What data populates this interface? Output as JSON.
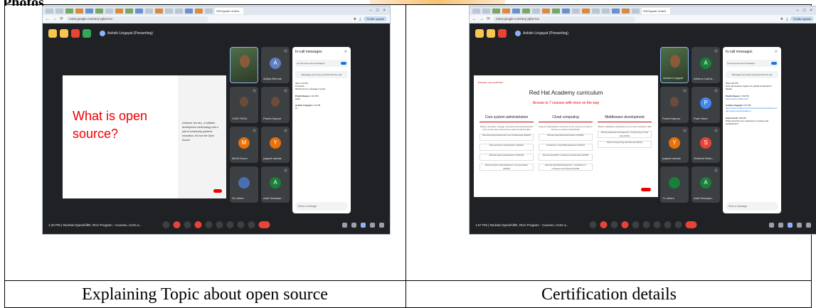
{
  "heading": "Photos",
  "captions": {
    "left": "Explaining Topic about open source",
    "right": "Certification details"
  },
  "shot_common": {
    "tab_title": "ISKOguide United States",
    "url": "meet.google.com/any-jqhw-ivo",
    "profile": "Profile update",
    "presenting": "Ashish Lingayat (Presenting)",
    "chat_title": "In-call messages",
    "chat_toggle": "Let everyone send messages",
    "chat_note": "Messages are being recorded with the call",
    "send_placeholder": "Send a message",
    "meeting_name": "RedHat OpenshiftR, RHA Program - Courses, Certs a..."
  },
  "shot1": {
    "time": "1:20 PM",
    "slide_title": "What is open source?",
    "slide_side": "A license, fan-dev., a software development methodology and a part of community-powered innovation. It's how the Open Source",
    "tiles": [
      {
        "name": "",
        "initial": "",
        "color": "cam"
      },
      {
        "name": "Aditya Bhende",
        "initial": "A",
        "color": "#5f7fbf"
      },
      {
        "name": "VINIT PATIL",
        "initial": "",
        "color": "photo"
      },
      {
        "name": "Prachi Kapoor",
        "initial": "",
        "color": "photo"
      },
      {
        "name": "Mohit Doore",
        "initial": "M",
        "color": "#e8710a"
      },
      {
        "name": "yogesh sabale",
        "initial": "Y",
        "color": "#e8710a"
      },
      {
        "name": "29 others",
        "initial": "",
        "color": "#4a6fb0"
      },
      {
        "name": "Aarti Deshpan...",
        "initial": "A",
        "color": "#188038"
      }
    ],
    "messages": [
      {
        "who": "You",
        "time": "1:13 PM",
        "text": "Hi Ashish",
        "extra": "Would send a message in pretti"
      },
      {
        "who": "Prachi Kapoor",
        "time": "1:16 PM",
        "text": "Hello",
        "extra": ""
      },
      {
        "who": "Ashish Lingayat",
        "time": "1:16 PM",
        "text": "Hi",
        "extra": ""
      }
    ]
  },
  "shot2": {
    "time": "1:57 PM",
    "slide_tiny": "Education and certification",
    "slide_title": "Red Hat Academy curriculum",
    "slide_sub": "Access to 7 courses with more on the way",
    "columns": [
      {
        "h": "Core system administration",
        "d": "Deploy, administer, manage, and secure Red Hat Enterprise Linux on the way to becoming a systems administrator",
        "boxes": [
          "Red Hat Getting Started with Linux Fundamentals (RH104)",
          "Red Hat System Administration I (RH124)",
          "Red Hat System Administration II (RH134)",
          "Red Hat System Administration III: Linux Automation (RH294)"
        ]
      },
      {
        "h": "Cloud computing",
        "d": "Support organizational movement to the cloud as you train to become a systems administrator",
        "boxes": [
          "Red Hat OpenShift Administration I (DO280)",
          "Introduction to OpenShift Applications (DO101)",
          "Red Hat OpenShift I: Containers & Kubernetes (DO180)",
          "Red Hat OpenShift Development I: Introduction to Containers with Podman (DO188)"
        ]
      },
      {
        "h": "Middleware development",
        "d": "Master middleware applications as you learn developer skills",
        "boxes": [
          "Red Hat Application Development I: Programming in Java EE (AD183)",
          "Python Programming with Red Hat (AD141)"
        ]
      }
    ],
    "tiles": [
      {
        "name": "Ashish Lingayat",
        "initial": "",
        "color": "cam"
      },
      {
        "name": "Atharva Lakha...",
        "initial": "A",
        "color": "#188038"
      },
      {
        "name": "Prachi Kapoor",
        "initial": "",
        "color": "photo"
      },
      {
        "name": "Parth Wani",
        "initial": "P",
        "color": "#4285f4"
      },
      {
        "name": "yogesh sabale",
        "initial": "Y",
        "color": "#e8710a"
      },
      {
        "name": "Shridhar Bhan...",
        "initial": "S",
        "color": "#ea4335"
      },
      {
        "name": "71 others",
        "initial": "",
        "color": "#188038"
      },
      {
        "name": "Aarti Deshpan...",
        "initial": "A",
        "color": "#188038"
      }
    ],
    "messages": [
      {
        "who": "You",
        "time": "1:49 PM",
        "text": "How will students register for global certification?",
        "extra": "thanks"
      },
      {
        "who": "Prachi Kapoor",
        "time": "1:49 PM",
        "text": "https://www.redhat.com/",
        "extra": ""
      },
      {
        "who": "Ashish Lingayat",
        "time": "1:53 PM",
        "text": "https://www.redhat.com/en/services/training/rh124-red-hat-system-administration-i",
        "extra": ""
      },
      {
        "who": "Gauri Joshi",
        "time": "1:56 PM",
        "text": "What should be the roadmap for courses and certifications?",
        "extra": ""
      }
    ]
  }
}
